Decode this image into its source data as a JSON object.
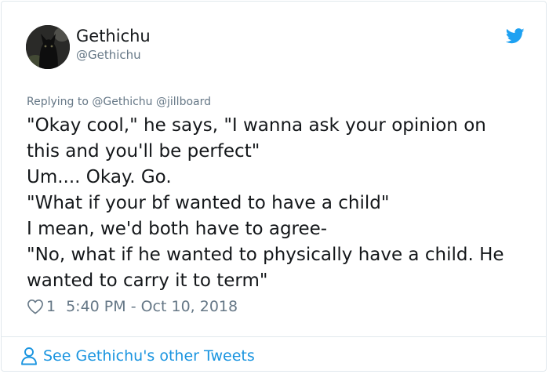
{
  "author": {
    "display_name": "Gethichu",
    "handle": "@Gethichu",
    "avatar_icon": "black-cat-avatar"
  },
  "brand": {
    "icon": "twitter-bird-icon",
    "color": "#1da1f2"
  },
  "reply_context": {
    "prefix": "Replying to",
    "mentions": [
      "@Gethichu",
      "@jillboard"
    ]
  },
  "tweet": {
    "lines": [
      "\"Okay cool,\" he says, \"I wanna ask your opinion on",
      "this and you'll be perfect\"",
      "Um.... Okay. Go.",
      "\"What if your bf wanted to have a child\"",
      "I mean, we'd both have to agree-",
      "\"No, what if he wanted to physically have a child. He",
      "wanted to carry it to term\""
    ]
  },
  "meta": {
    "like_icon": "heart-outline-icon",
    "like_count": "1",
    "timestamp": "5:40 PM - Oct 10, 2018"
  },
  "footer": {
    "icon": "user-icon",
    "label": "See Gethichu's other Tweets",
    "color": "#1b95e0"
  },
  "colors": {
    "text_primary": "#14171a",
    "text_secondary": "#657786",
    "border": "#e1e8ed"
  }
}
